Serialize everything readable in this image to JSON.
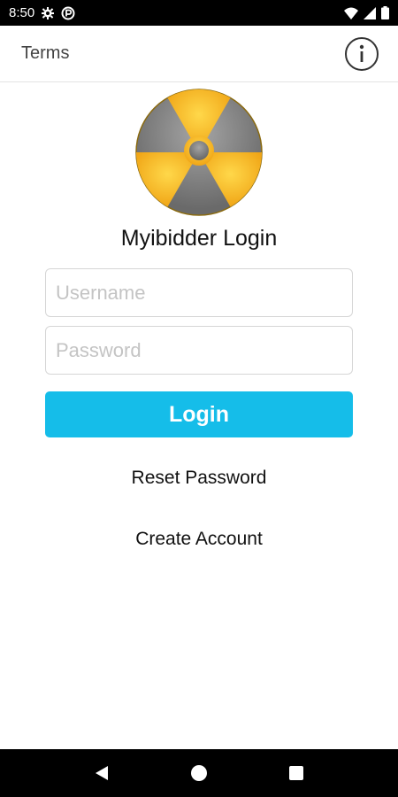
{
  "status_bar": {
    "time": "8:50",
    "icons": [
      "gear-icon",
      "circle-p-icon",
      "wifi-icon",
      "signal-icon",
      "battery-icon"
    ]
  },
  "header": {
    "terms_label": "Terms",
    "info_icon": "info-icon"
  },
  "main": {
    "logo_icon": "radiation-logo",
    "title": "Myibidder Login",
    "username_placeholder": "Username",
    "password_placeholder": "Password",
    "login_label": "Login",
    "reset_label": "Reset Password",
    "create_label": "Create Account"
  },
  "colors": {
    "accent": "#15bde9",
    "logo_yellow": "#f5b21e",
    "logo_gray": "#7d7d7d"
  },
  "nav_bar": {
    "icons": [
      "back-icon",
      "home-icon",
      "recents-icon"
    ]
  }
}
